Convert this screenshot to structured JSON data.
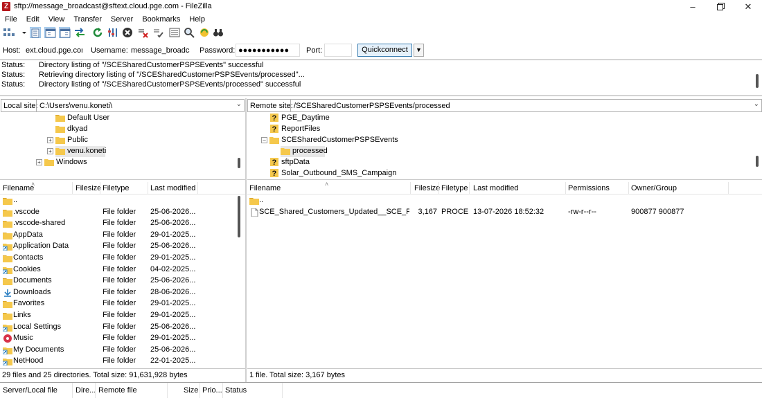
{
  "window": {
    "title": "sftp://message_broadcast@sftext.cloud.pge.com - FileZilla",
    "app_icon_letter": "Z",
    "buttons": [
      "minimize",
      "maximize",
      "close"
    ]
  },
  "menu": [
    "File",
    "Edit",
    "View",
    "Transfer",
    "Server",
    "Bookmarks",
    "Help"
  ],
  "toolbar": [
    "site-manager-icon",
    "toggle-log-icon",
    "toggle-local-tree-icon",
    "toggle-remote-tree-icon",
    "toggle-queue-icon",
    "refresh-icon",
    "process-queue-icon",
    "cancel-icon",
    "disconnect-icon",
    "reconnect-icon",
    "directory-filter-icon",
    "search-icon",
    "sync-browse-icon",
    "compare-icon"
  ],
  "quickconnect": {
    "host_label": "Host:",
    "host_value": "ext.cloud.pge.com",
    "username_label": "Username:",
    "username_value": "message_broadcast",
    "password_label": "Password:",
    "password_value": "●●●●●●●●●●●",
    "port_label": "Port:",
    "port_value": "",
    "button": "Quickconnect"
  },
  "log": [
    {
      "key": "Status:",
      "msg": "Directory listing of \"/SCESharedCustomerPSPSEvents\" successful"
    },
    {
      "key": "Status:",
      "msg": "Retrieving directory listing of \"/SCESharedCustomerPSPSEvents/processed\"..."
    },
    {
      "key": "Status:",
      "msg": "Directory listing of \"/SCESharedCustomerPSPSEvents/processed\" successful"
    }
  ],
  "local": {
    "site_label": "Local site:",
    "site_path": "C:\\Users\\venu.koneti\\",
    "tree": [
      {
        "label": "Default User"
      },
      {
        "label": "dkyad"
      },
      {
        "label": "Public"
      },
      {
        "label": "venu.koneti"
      },
      {
        "label": "Windows"
      }
    ],
    "headers": [
      "Filename",
      "Filesize",
      "Filetype",
      "Last modified"
    ],
    "files": [
      {
        "name": "..",
        "size": "",
        "type": "",
        "modified": ""
      },
      {
        "name": ".vscode",
        "size": "",
        "type": "File folder",
        "modified": "25-06-2026..."
      },
      {
        "name": ".vscode-shared",
        "size": "",
        "type": "File folder",
        "modified": "25-06-2026..."
      },
      {
        "name": "AppData",
        "size": "",
        "type": "File folder",
        "modified": "29-01-2025..."
      },
      {
        "name": "Application Data",
        "size": "",
        "type": "File folder",
        "modified": "25-06-2026..."
      },
      {
        "name": "Contacts",
        "size": "",
        "type": "File folder",
        "modified": "29-01-2025..."
      },
      {
        "name": "Cookies",
        "size": "",
        "type": "File folder",
        "modified": "04-02-2025..."
      },
      {
        "name": "Documents",
        "size": "",
        "type": "File folder",
        "modified": "25-06-2026..."
      },
      {
        "name": "Downloads",
        "size": "",
        "type": "File folder",
        "modified": "28-06-2026..."
      },
      {
        "name": "Favorites",
        "size": "",
        "type": "File folder",
        "modified": "29-01-2025..."
      },
      {
        "name": "Links",
        "size": "",
        "type": "File folder",
        "modified": "29-01-2025..."
      },
      {
        "name": "Local Settings",
        "size": "",
        "type": "File folder",
        "modified": "25-06-2026..."
      },
      {
        "name": "Music",
        "size": "",
        "type": "File folder",
        "modified": "29-01-2025..."
      },
      {
        "name": "My Documents",
        "size": "",
        "type": "File folder",
        "modified": "25-06-2026..."
      },
      {
        "name": "NetHood",
        "size": "",
        "type": "File folder",
        "modified": "22-01-2025..."
      }
    ],
    "status": "29 files and 25 directories. Total size: 91,631,928 bytes"
  },
  "remote": {
    "site_label": "Remote site:",
    "site_path": "/SCESharedCustomerPSPSEvents/processed",
    "tree": [
      {
        "label": "PGE_Daytime"
      },
      {
        "label": "ReportFiles"
      },
      {
        "label": "SCESharedCustomerPSPSEvents"
      },
      {
        "label": "processed"
      },
      {
        "label": "sftpData"
      },
      {
        "label": "Solar_Outbound_SMS_Campaign"
      }
    ],
    "headers": [
      "Filename",
      "Filesize",
      "Filetype",
      "Last modified",
      "Permissions",
      "Owner/Group"
    ],
    "files": [
      {
        "name": "..",
        "size": "",
        "type": "",
        "modified": "",
        "perms": "",
        "owner": ""
      },
      {
        "name": "SCE_Shared_Customers_Updated__SCE_PSPS_...",
        "size": "3,167",
        "type": "PROCE...",
        "modified": "13-07-2026 18:52:32",
        "perms": "-rw-r--r--",
        "owner": "900877 900877"
      }
    ],
    "status": "1 file. Total size: 3,167 bytes"
  },
  "queue": {
    "headers": [
      "Server/Local file",
      "Dire...",
      "Remote file",
      "Size",
      "Prio...",
      "Status"
    ]
  },
  "colors": {
    "folder": "#f5c84c",
    "folder_dark": "#dba52a",
    "accent": "#3c7fb1"
  }
}
